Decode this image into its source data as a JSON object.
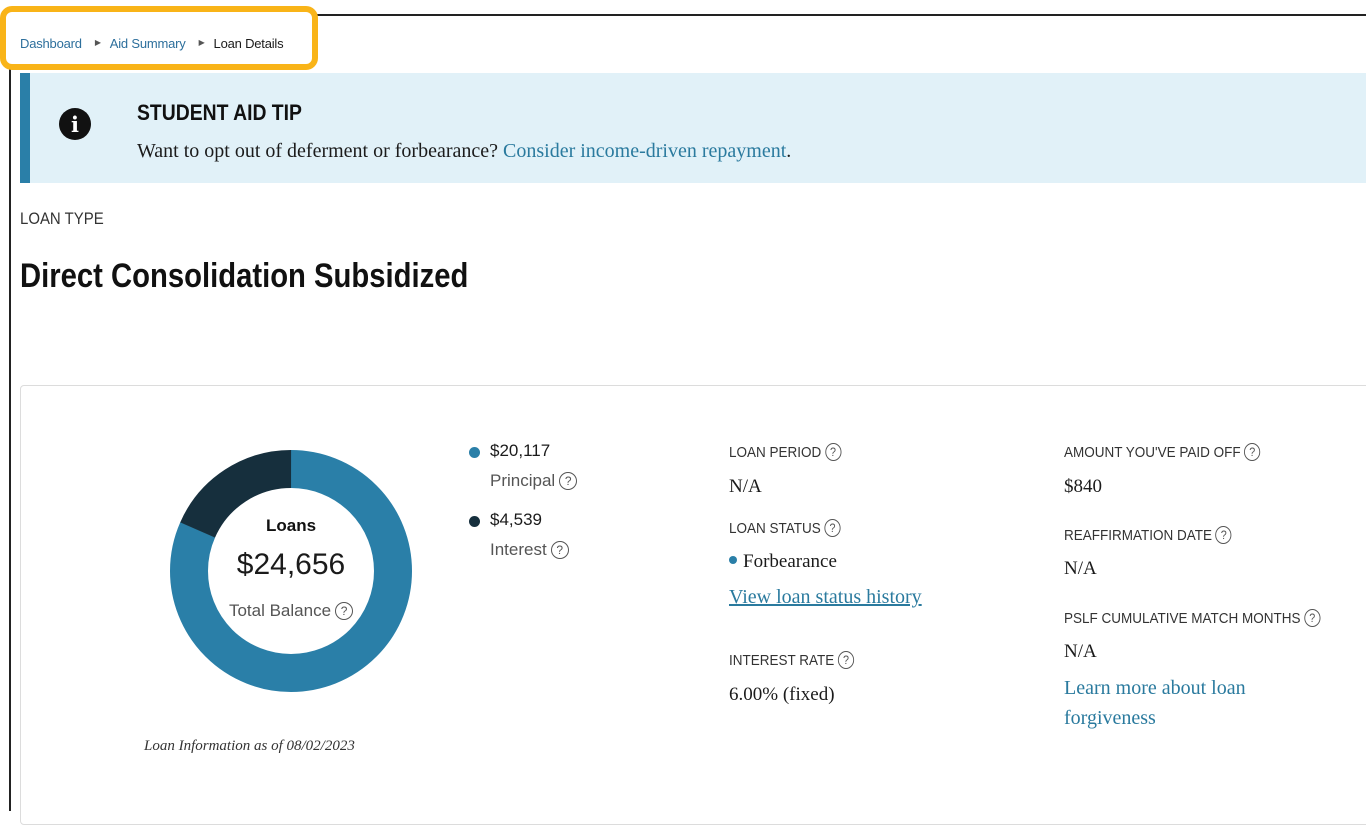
{
  "breadcrumb": {
    "items": [
      "Dashboard",
      "Aid Summary"
    ],
    "current": "Loan Details"
  },
  "tip": {
    "title": "STUDENT AID TIP",
    "text": "Want to opt out of deferment or forbearance? ",
    "link": "Consider income-driven repayment",
    "text_end": "."
  },
  "loan_type": {
    "label": "LOAN TYPE",
    "title": "Direct Consolidation Subsidized"
  },
  "balance": {
    "center_title": "Loans",
    "total": "$24,656",
    "total_caption": "Total Balance",
    "as_of": "Loan Information as of 08/02/2023",
    "principal_amount": "$20,117",
    "principal_label": "Principal",
    "interest_amount": "$4,539",
    "interest_label": "Interest",
    "principal_value": 20117,
    "interest_value": 4539,
    "principal_color": "#2a7fa8",
    "interest_color": "#162f3d"
  },
  "details": {
    "loan_period_label": "LOAN PERIOD",
    "loan_period_value": "N/A",
    "loan_status_label": "LOAN STATUS",
    "loan_status_value": "Forbearance",
    "status_history_link": "View loan status history",
    "interest_rate_label": "INTEREST RATE",
    "interest_rate_value": "6.00% (fixed)",
    "paid_off_label": "AMOUNT YOU'VE PAID OFF",
    "paid_off_value": "$840",
    "reaffirmation_label": "REAFFIRMATION DATE",
    "reaffirmation_value": "N/A",
    "pslf_label": "PSLF CUMULATIVE MATCH MONTHS",
    "pslf_value": "N/A",
    "forgiveness_link_line1": "Learn more about loan",
    "forgiveness_link_line2": "forgiveness"
  },
  "icons": {
    "tip": "info-icon",
    "help": "help-circle-icon",
    "crumb_separator": "triangle-right-icon"
  }
}
